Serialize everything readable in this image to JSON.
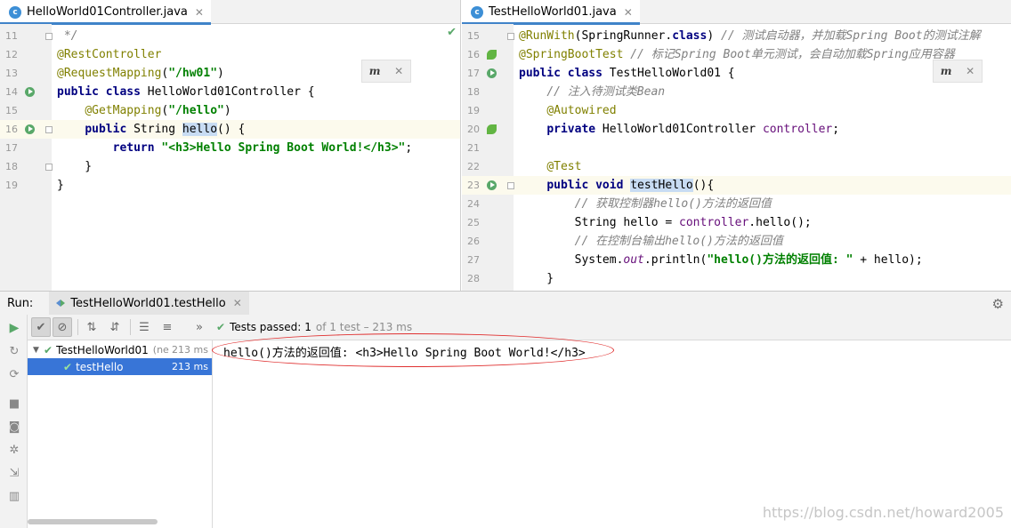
{
  "left_editor": {
    "tab": {
      "label": "HelloWorld01Controller.java",
      "icon": "class-icon"
    },
    "lines": [
      {
        "n": "11",
        "html": "<span class=\"cmt\"> */</span>"
      },
      {
        "n": "12",
        "html": "<span class=\"ann\">@RestController</span>"
      },
      {
        "n": "13",
        "html": "<span class=\"ann\">@RequestMapping</span>(<span class=\"str\">\"/hw01\"</span>)"
      },
      {
        "n": "14",
        "html": "<span class=\"kw\">public class</span> HelloWorld01Controller {"
      },
      {
        "n": "15",
        "html": "    <span class=\"ann\">@GetMapping</span>(<span class=\"str\">\"/hello\"</span>)"
      },
      {
        "n": "16",
        "html": "    <span class=\"kw\">public</span> String <span class=\"hl\">hello</span>() {"
      },
      {
        "n": "17",
        "html": "        <span class=\"kw\">return</span> <span class=\"str\">\"&lt;h3&gt;Hello Spring Boot World!&lt;/h3&gt;\"</span>;"
      },
      {
        "n": "18",
        "html": "    }"
      },
      {
        "n": "19",
        "html": "}"
      }
    ]
  },
  "right_editor": {
    "tab": {
      "label": "TestHelloWorld01.java",
      "icon": "class-icon"
    },
    "lines": [
      {
        "n": "15",
        "html": "<span class=\"ann\">@RunWith</span>(SpringRunner.<span class=\"kw\">class</span>) <span class=\"cmt\">// 测试启动器，并加载Spring Boot的测试注解</span>"
      },
      {
        "n": "16",
        "html": "<span class=\"ann\">@SpringBootTest</span> <span class=\"cmt\">// 标记Spring Boot单元测试，会自动加载Spring应用容器</span>"
      },
      {
        "n": "17",
        "html": "<span class=\"kw\">public class</span> TestHelloWorld01 {"
      },
      {
        "n": "18",
        "html": "    <span class=\"cmt\">// 注入待测试类Bean</span>"
      },
      {
        "n": "19",
        "html": "    <span class=\"ann\">@Autowired</span>"
      },
      {
        "n": "20",
        "html": "    <span class=\"kw\">private</span> HelloWorld01Controller <span class=\"fld\">controller</span>;"
      },
      {
        "n": "21",
        "html": ""
      },
      {
        "n": "22",
        "html": "    <span class=\"ann\">@Test</span>"
      },
      {
        "n": "23",
        "html": "    <span class=\"kw\">public void</span> <span class=\"hl\">testHello</span>(){"
      },
      {
        "n": "24",
        "html": "        <span class=\"cmt\">// 获取控制器hello()方法的返回值</span>"
      },
      {
        "n": "25",
        "html": "        String hello = <span class=\"fld\">controller</span>.hello();"
      },
      {
        "n": "26",
        "html": "        <span class=\"cmt\">// 在控制台输出hello()方法的返回值</span>"
      },
      {
        "n": "27",
        "html": "        System.<span class=\"fldi\">out</span>.println(<span class=\"str\">\"hello()方法的返回值: \"</span> + hello);"
      },
      {
        "n": "28",
        "html": "    }"
      }
    ]
  },
  "run_panel": {
    "label": "Run:",
    "tab_label": "TestHelloWorld01.testHello",
    "status": {
      "passed_label": "Tests passed:",
      "passed_count": "1",
      "detail": "of 1 test – 213 ms"
    },
    "tree": [
      {
        "label": "TestHelloWorld01",
        "extra": "(ne",
        "time": "213 ms"
      },
      {
        "label": "testHello",
        "time": "213 ms"
      }
    ],
    "console_output": "hello()方法的返回值: <h3>Hello Spring Boot World!</h3>"
  },
  "watermark": "https://blog.csdn.net/howard2005",
  "colors": {
    "accent": "#4083c9",
    "selection": "#3875d7",
    "pass_green": "#59a869",
    "annotation_circle": "#e03030"
  }
}
